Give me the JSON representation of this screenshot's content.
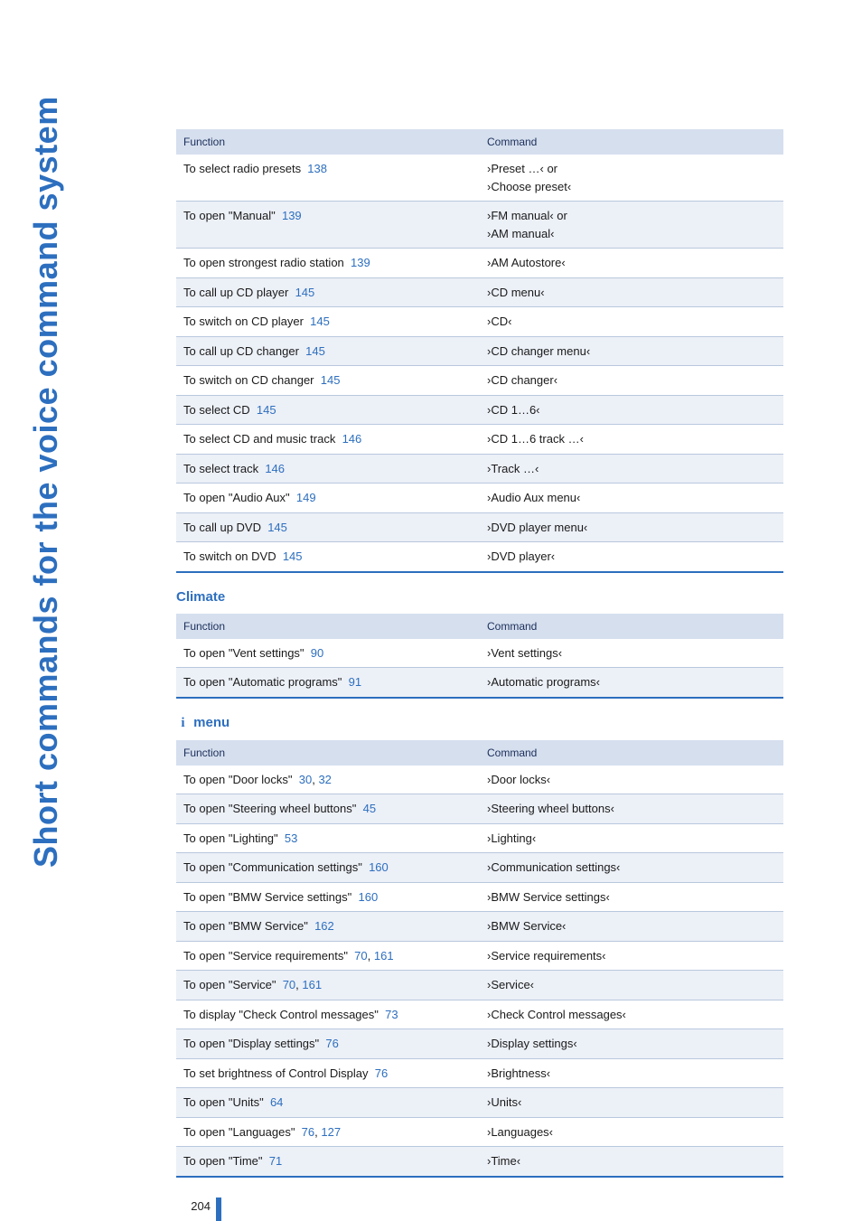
{
  "side_label": "Short commands for the voice command system",
  "page_number": "204",
  "tables": {
    "t1": {
      "h_func": "Function",
      "h_cmd": "Command",
      "rows": [
        {
          "func": "To select radio presets",
          "page": "138",
          "cmd": "›Preset …‹ or\n›Choose preset‹"
        },
        {
          "func": "To open \"Manual\"",
          "page": "139",
          "cmd": "›FM manual‹ or\n›AM manual‹"
        },
        {
          "func": "To open strongest radio station",
          "page": "139",
          "cmd": "›AM Autostore‹"
        },
        {
          "func": "To call up CD player",
          "page": "145",
          "cmd": "›CD menu‹"
        },
        {
          "func": "To switch on CD player",
          "page": "145",
          "cmd": "›CD‹"
        },
        {
          "func": "To call up CD changer",
          "page": "145",
          "cmd": "›CD changer menu‹"
        },
        {
          "func": "To switch on CD changer",
          "page": "145",
          "cmd": "›CD changer‹"
        },
        {
          "func": "To select CD",
          "page": "145",
          "cmd": "›CD 1…6‹"
        },
        {
          "func": "To select CD and music track",
          "page": "146",
          "cmd": "›CD 1…6 track …‹"
        },
        {
          "func": "To select track",
          "page": "146",
          "cmd": "›Track …‹"
        },
        {
          "func": "To open \"Audio Aux\"",
          "page": "149",
          "cmd": "›Audio Aux menu‹"
        },
        {
          "func": "To call up DVD",
          "page": "145",
          "cmd": "›DVD player menu‹"
        },
        {
          "func": "To switch on DVD",
          "page": "145",
          "cmd": "›DVD player‹"
        }
      ]
    },
    "t2": {
      "title": "Climate",
      "h_func": "Function",
      "h_cmd": "Command",
      "rows": [
        {
          "func": "To open \"Vent settings\"",
          "page": "90",
          "cmd": "›Vent settings‹"
        },
        {
          "func": "To open \"Automatic programs\"",
          "page": "91",
          "cmd": "›Automatic programs‹"
        }
      ]
    },
    "t3": {
      "title_icon": "i",
      "title_rest": " menu",
      "h_func": "Function",
      "h_cmd": "Command",
      "rows": [
        {
          "func": "To open \"Door locks\"",
          "page": "30",
          "page2": "32",
          "cmd": "›Door locks‹"
        },
        {
          "func": "To open \"Steering wheel buttons\"",
          "page": "45",
          "cmd": "›Steering wheel buttons‹"
        },
        {
          "func": "To open \"Lighting\"",
          "page": "53",
          "cmd": "›Lighting‹"
        },
        {
          "func": "To open \"Communication settings\"",
          "page": "160",
          "cmd": "›Communication settings‹"
        },
        {
          "func": "To open \"BMW Service settings\"",
          "page": "160",
          "cmd": "›BMW Service settings‹"
        },
        {
          "func": "To open \"BMW Service\"",
          "page": "162",
          "cmd": "›BMW Service‹"
        },
        {
          "func": "To open \"Service requirements\"",
          "page": "70",
          "page2": "161",
          "cmd": "›Service requirements‹"
        },
        {
          "func": "To open \"Service\"",
          "page": "70",
          "page2": "161",
          "cmd": "›Service‹"
        },
        {
          "func": "To display \"Check Control messages\"",
          "page": "73",
          "cmd": "›Check Control messages‹"
        },
        {
          "func": "To open \"Display settings\"",
          "page": "76",
          "cmd": "›Display settings‹"
        },
        {
          "func": "To set brightness of Control Display",
          "page": "76",
          "cmd": "›Brightness‹"
        },
        {
          "func": "To open \"Units\"",
          "page": "64",
          "cmd": "›Units‹"
        },
        {
          "func": "To open \"Languages\"",
          "page": "76",
          "page2": "127",
          "cmd": "›Languages‹"
        },
        {
          "func": "To open \"Time\"",
          "page": "71",
          "cmd": "›Time‹"
        }
      ]
    }
  }
}
